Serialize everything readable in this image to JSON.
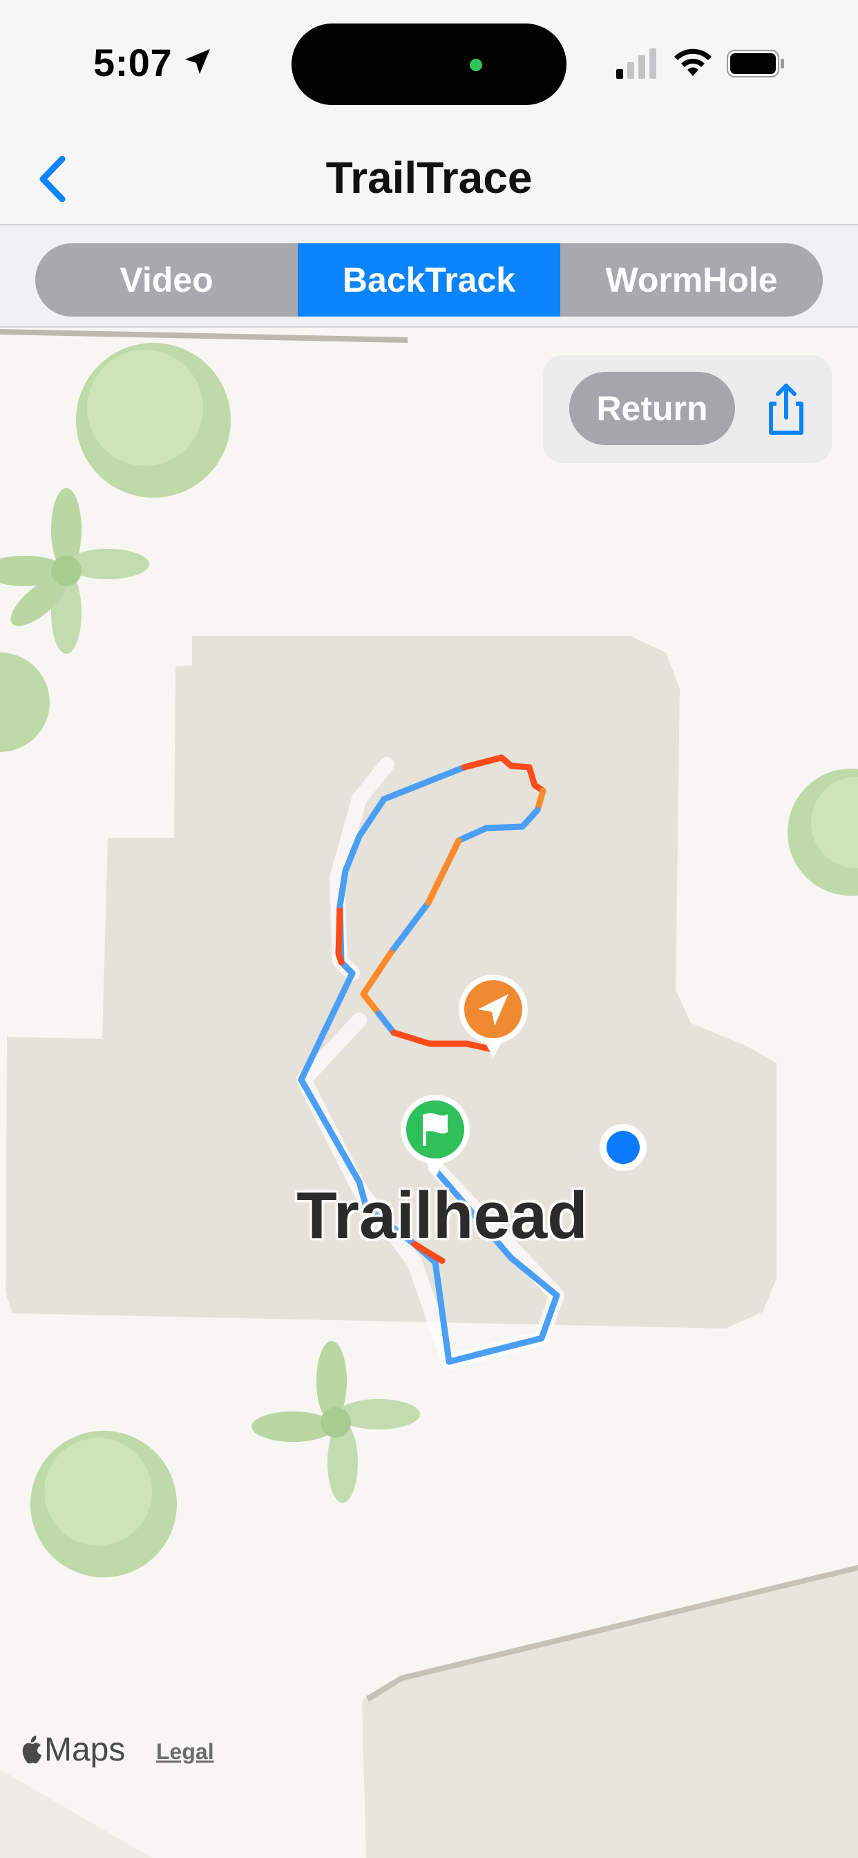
{
  "status_bar": {
    "time": "5:07"
  },
  "nav": {
    "title": "TrailTrace"
  },
  "segments": [
    {
      "label": "Video",
      "active": false
    },
    {
      "label": "BackTrack",
      "active": true
    },
    {
      "label": "WormHole",
      "active": false
    }
  ],
  "toolbar": {
    "return_label": "Return"
  },
  "map": {
    "place_label": "Trailhead",
    "attribution": "Maps",
    "legal_label": "Legal"
  },
  "colors": {
    "accent": "#0a84ff",
    "track_blue": "#4a9ff5",
    "track_orange": "#ff8a2a",
    "track_red": "#ff4a1a",
    "start_flag": "#2fc05a",
    "current_pin": "#f08a30"
  },
  "icons": [
    "back-chevron-icon",
    "location-arrow-icon",
    "signal-icon",
    "wifi-icon",
    "battery-icon",
    "share-icon",
    "flag-icon",
    "navigation-arrow-icon",
    "apple-logo-icon"
  ]
}
